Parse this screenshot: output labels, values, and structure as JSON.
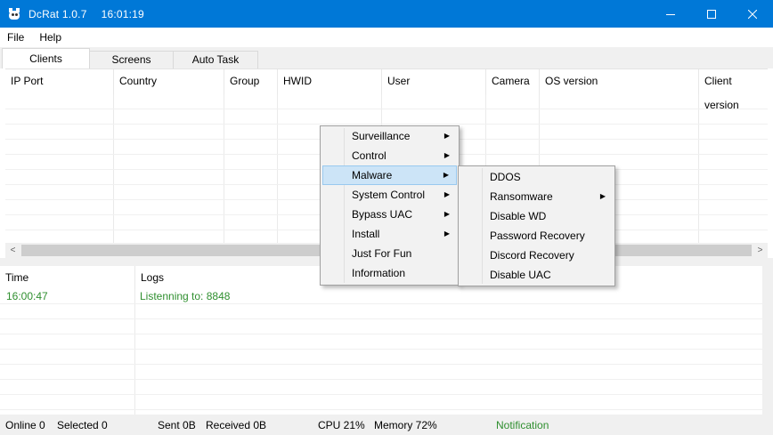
{
  "window": {
    "app_name": "DcRat  1.0.7",
    "time": "16:01:19",
    "minimize": "—",
    "maximize": "☐",
    "close": "✕"
  },
  "menu": [
    "File",
    "Help"
  ],
  "tabs": [
    "Clients",
    "Screens",
    "Auto Task"
  ],
  "clients_table": {
    "columns": [
      "IP Port",
      "Country",
      "Group",
      "HWID",
      "User",
      "Camera",
      "OS version",
      "Client version"
    ]
  },
  "scrollbar": {
    "left": "<",
    "right": ">"
  },
  "logs_table": {
    "columns": [
      "Time",
      "Logs"
    ],
    "rows": [
      {
        "time": "16:00:47",
        "message": "Listenning to: 8848"
      }
    ]
  },
  "status": {
    "online": "Online 0",
    "selected": "Selected 0",
    "sent": "Sent 0B",
    "received": "Received  0B",
    "cpu": "CPU 21%",
    "memory": "Memory 72%",
    "notification": "Notification"
  },
  "context_menu": {
    "items": [
      "Surveillance",
      "Control",
      "Malware",
      "System Control",
      "Bypass UAC",
      "Install",
      "Just For Fun",
      "Information"
    ],
    "highlighted": "Malware",
    "arrow": "▶"
  },
  "submenu": {
    "items": [
      "DDOS",
      "Ransomware",
      "Disable WD",
      "Password Recovery",
      "Discord Recovery",
      "Disable UAC"
    ]
  },
  "colors": {
    "titlebar": "#0078d7",
    "log_green": "#2f8f2f",
    "highlight": "#cce4f7"
  }
}
